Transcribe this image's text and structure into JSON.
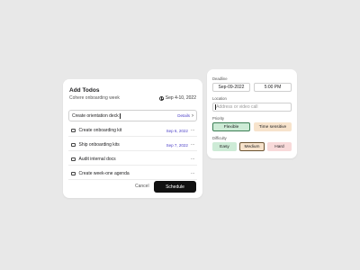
{
  "todos": {
    "title": "Add Todos",
    "subtitle": "Cohere onboarding week",
    "date": "Sep 4-10, 2022",
    "active_input": "Create orientation deck",
    "details_label": "Details",
    "items": [
      {
        "label": "Create onboarding kit",
        "date": "Sep 6, 2022",
        "more": "···"
      },
      {
        "label": "Ship onboarding kits",
        "date": "Sep 7, 2022",
        "more": "···"
      },
      {
        "label": "Audit internal docs",
        "date": "",
        "more": "···"
      },
      {
        "label": "Create week-one agenda",
        "date": "",
        "more": "···"
      }
    ],
    "cancel_label": "Cancel",
    "schedule_label": "Schedule"
  },
  "schedule": {
    "deadline_label": "Deadline",
    "deadline_date": "Sep-09-2022",
    "deadline_time": "5:00 PM",
    "location_label": "Location",
    "location_placeholder": "Address or video call",
    "priority_label": "Priority",
    "priority_options": [
      "Flexible",
      "Time sensitive"
    ],
    "difficulty_label": "Difficulty",
    "difficulty_options": [
      "Easy",
      "Medium",
      "Hard"
    ]
  },
  "colors": {
    "accent": "#4b3fc7",
    "primary_button": "#111111",
    "green_chip": "#cdebd6",
    "orange_chip": "#f7e3cc",
    "red_chip": "#f8dada"
  }
}
